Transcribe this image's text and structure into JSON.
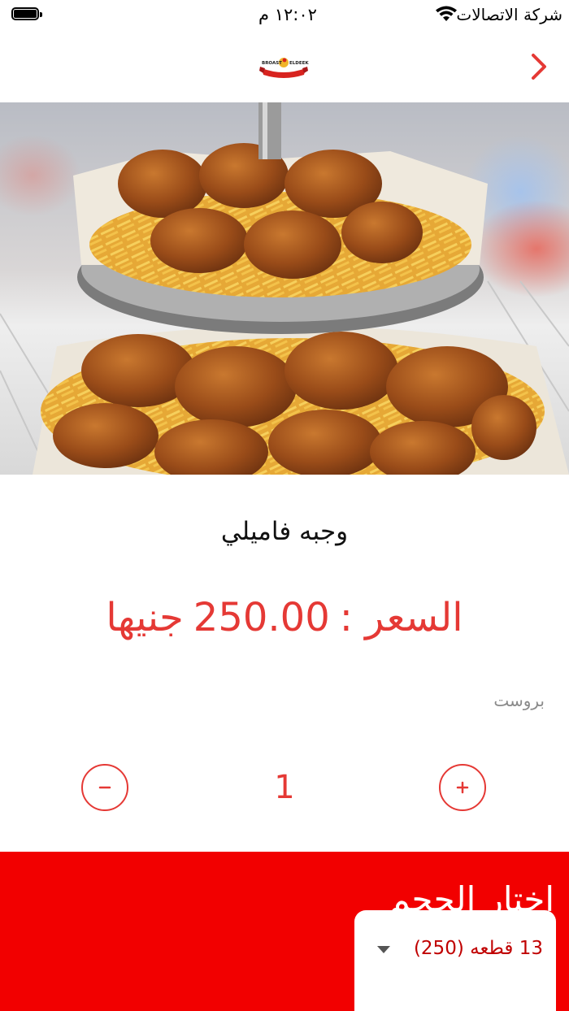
{
  "status_bar": {
    "carrier": "شركة الاتصالات",
    "time": "١٢:٠٢ م"
  },
  "nav": {
    "logo_text": "BROAST ELDEEK",
    "back_icon": "chevron-right-icon"
  },
  "product": {
    "name": "وجبه فاميلي",
    "price_label": "السعر :",
    "price_value": "250.00",
    "currency": "جنيها",
    "category": "بروست",
    "quantity": "1"
  },
  "size": {
    "title": "اختار الحجم",
    "selected": "13 قطعه     (250)"
  },
  "colors": {
    "accent": "#e53935",
    "panel": "#f20000"
  }
}
